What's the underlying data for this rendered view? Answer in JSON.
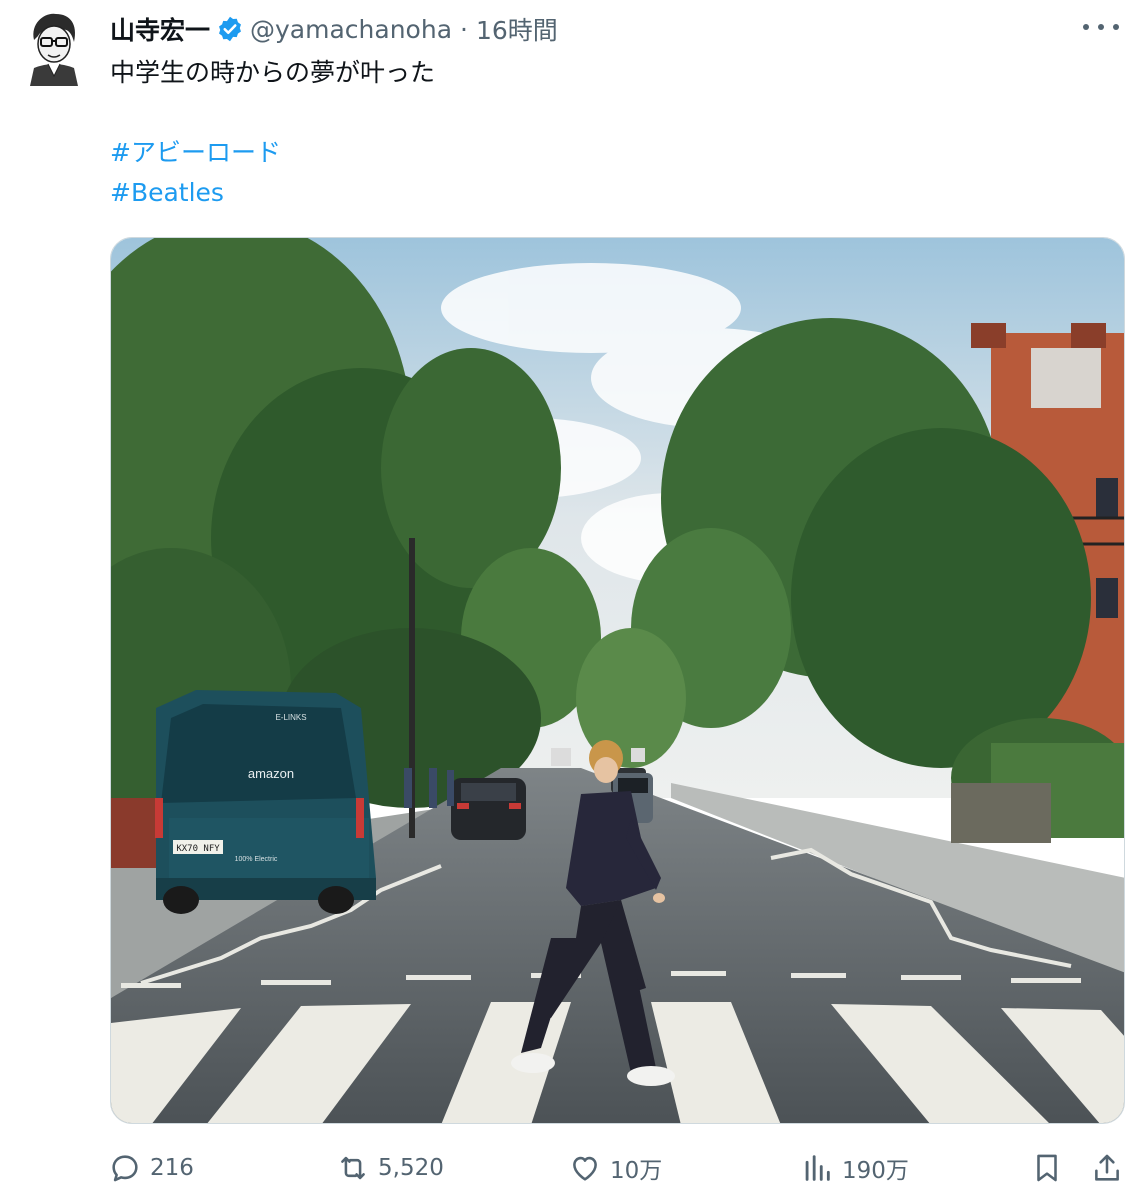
{
  "author": {
    "display_name": "山寺宏一",
    "handle": "@yamachanoha",
    "separator": "·",
    "time": "16時間",
    "verified": true,
    "avatar_icon": "caricature-avatar-icon"
  },
  "tweet": {
    "text": "中学生の時からの夢が叶った",
    "hashtags": [
      "#アビーロード",
      "#Beatles"
    ]
  },
  "media": {
    "sign_labels": {
      "van_brand": "amazon",
      "van_header": "E-LINKS",
      "plate": "KX70 NFY",
      "van_note": "100% Electric"
    }
  },
  "actions": {
    "reply": {
      "icon": "reply-icon",
      "count": "216"
    },
    "retweet": {
      "icon": "retweet-icon",
      "count": "5,520"
    },
    "like": {
      "icon": "heart-icon",
      "count": "10万"
    },
    "views": {
      "icon": "views-chart-icon",
      "count": "190万"
    },
    "bookmark": {
      "icon": "bookmark-icon"
    },
    "share": {
      "icon": "share-icon"
    }
  },
  "colors": {
    "link": "#1d9bf0",
    "secondary_text": "#536471",
    "verified": "#1d9bf0"
  }
}
